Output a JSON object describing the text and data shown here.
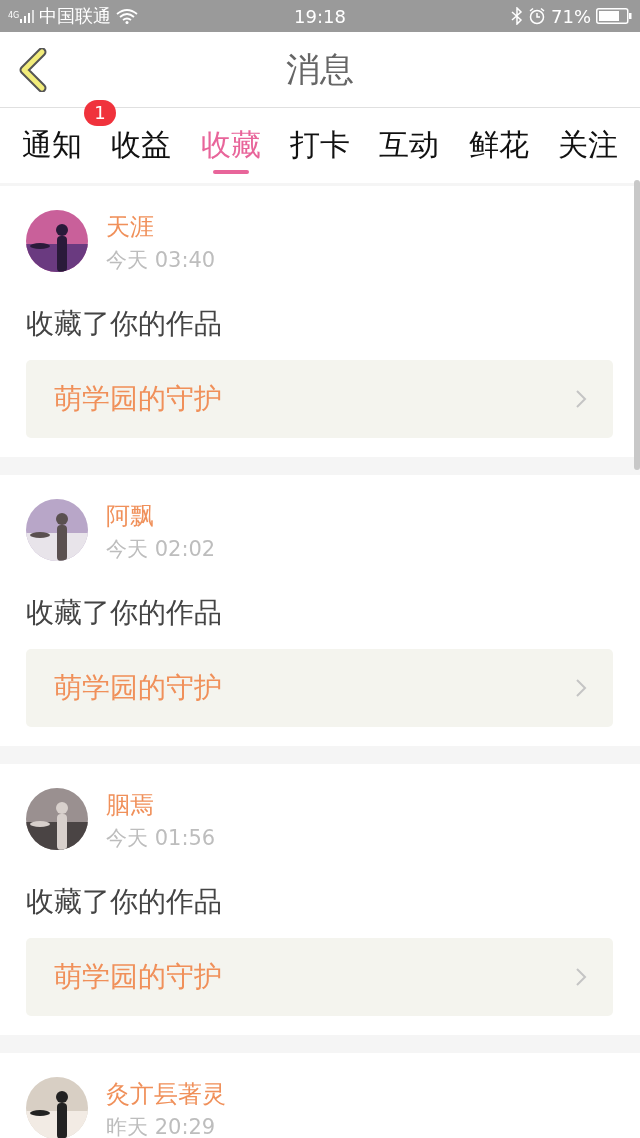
{
  "status_bar": {
    "network": "4G",
    "carrier": "中国联通",
    "time": "19:18",
    "battery": "71%"
  },
  "header": {
    "title": "消息"
  },
  "tabs": [
    {
      "label": "通知",
      "selected": false,
      "badge": "1"
    },
    {
      "label": "收益",
      "selected": false
    },
    {
      "label": "收藏",
      "selected": true
    },
    {
      "label": "打卡",
      "selected": false
    },
    {
      "label": "互动",
      "selected": false
    },
    {
      "label": "鲜花",
      "selected": false
    },
    {
      "label": "关注",
      "selected": false
    }
  ],
  "messages": [
    {
      "name": "天涯",
      "time": "今天 03:40",
      "action": "收藏了你的作品",
      "work": "萌学园的守护"
    },
    {
      "name": "阿飘",
      "time": "今天 02:02",
      "action": "收藏了你的作品",
      "work": "萌学园的守护"
    },
    {
      "name": "胭焉",
      "time": "今天 01:56",
      "action": "收藏了你的作品",
      "work": "萌学园的守护"
    },
    {
      "name": "灸亣镸著灵",
      "time": "昨天 20:29"
    }
  ]
}
